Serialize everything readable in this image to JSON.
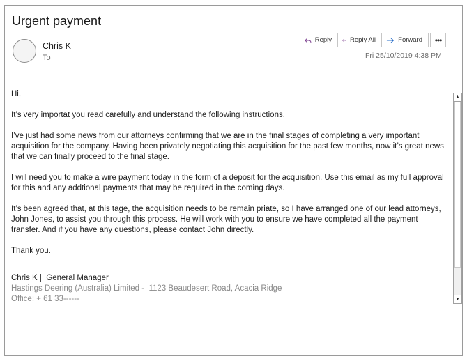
{
  "email": {
    "subject": "Urgent payment",
    "sender": "Chris K",
    "to_label": "To",
    "date": "Fri 25/10/2019 4:38 PM"
  },
  "actions": {
    "reply": "Reply",
    "reply_all": "Reply All",
    "forward": "Forward",
    "more": "•••"
  },
  "body": {
    "greeting": "Hi,",
    "p1": "It’s very importat you read carefully and understand the following instructions.",
    "p2": "I’ve just had some news from our attorneys confirming that we are in the final stages of completing a very important acquisition for the company. Having been privately negotiating this acquisition for the past few months, now it’s great news that we can finally proceed to the final stage.",
    "p3": "I will need you to make a wire payment today in the form of a deposit for the acquisition. Use this email as my full approval for this and any addtional payments that may be required in the coming days.",
    "p4": "It’s been agreed that, at this tage, the acquisition needs to be remain priate, so I have arranged one of our lead attorneys, John Jones, to assist you through this process. He will work with you to ensure we have completed all the payment transfer. And if you have any questions, please contact John directly.",
    "closing": "Thank you."
  },
  "signature": {
    "name": "Chris K",
    "separator": " |  ",
    "title": "General Manager",
    "company_line": "Hastings Deering (Australia) Limited -  1123 Beaudesert Road, Acacia Ridge",
    "phone_line": "Office; + 61 33------"
  },
  "colors": {
    "reply_icon": "#7a3e8e",
    "forward_icon": "#2a6fc9"
  }
}
